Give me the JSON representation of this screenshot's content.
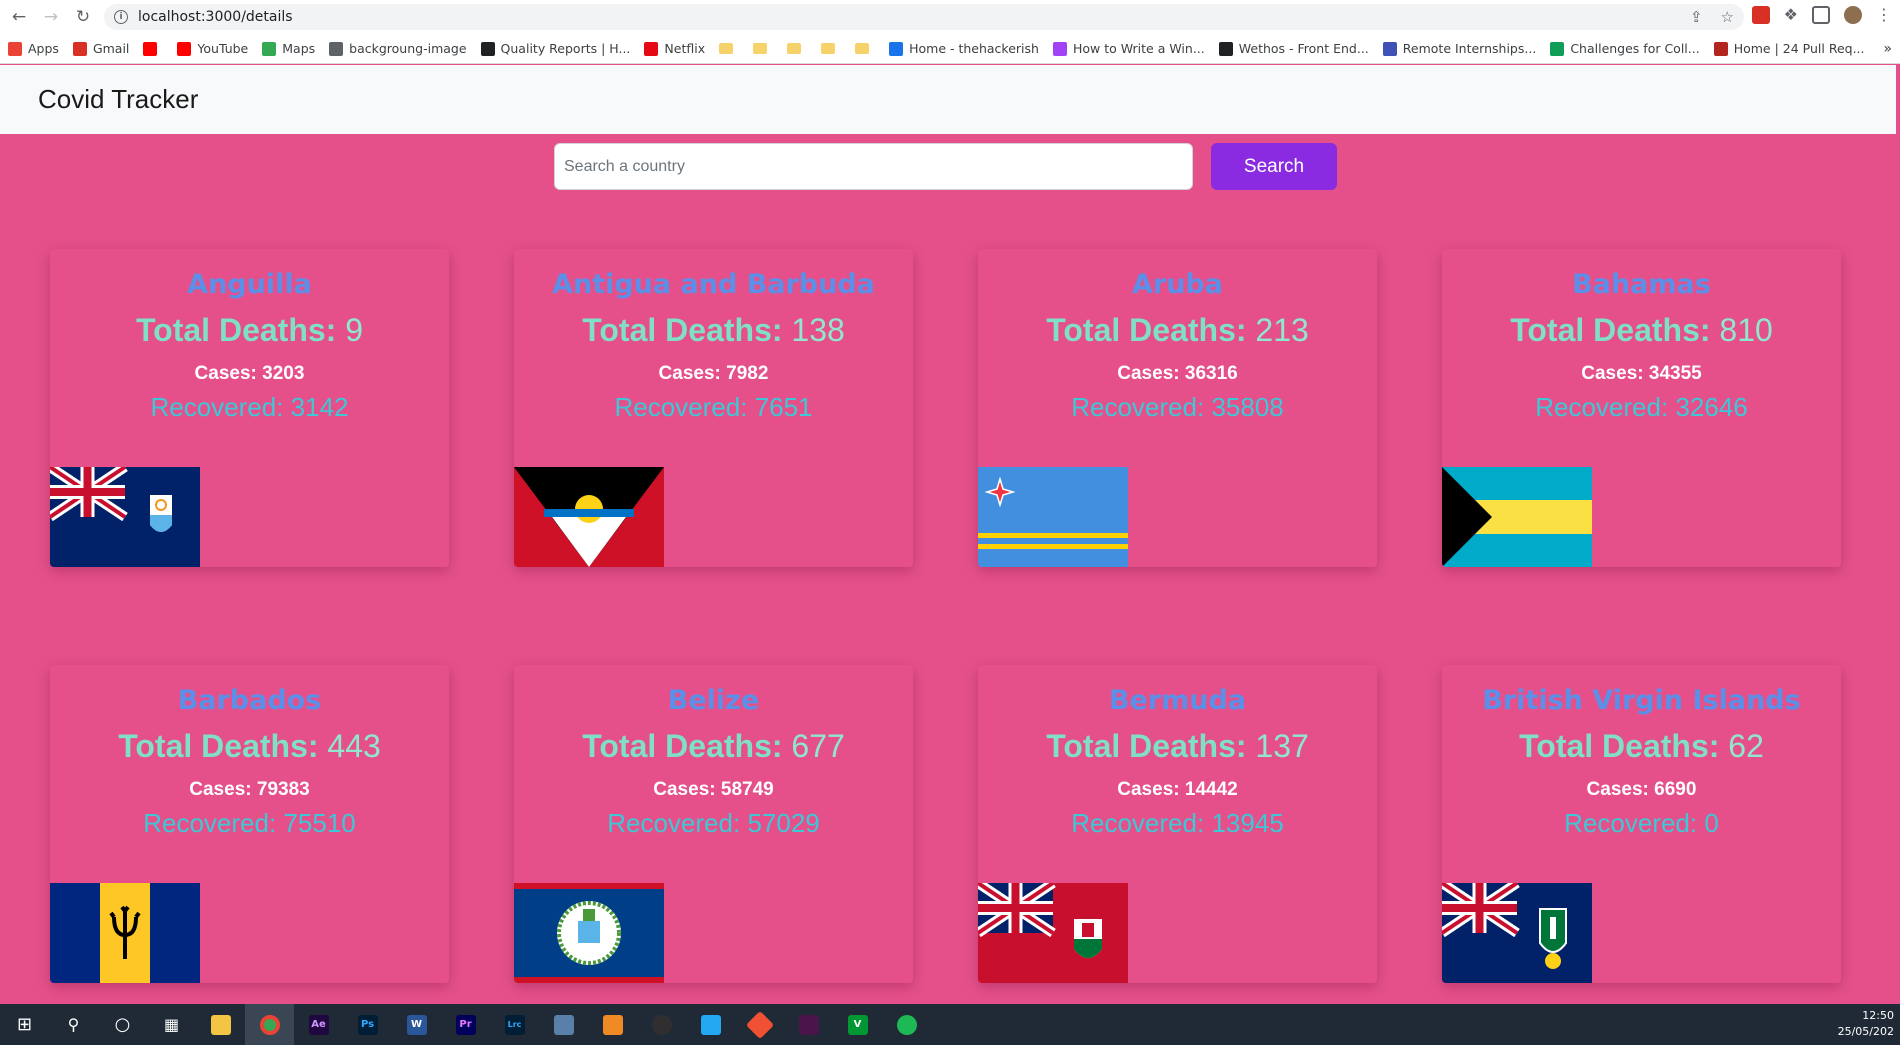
{
  "browser": {
    "url": "localhost:3000/details",
    "bookmarks": [
      {
        "label": "Apps",
        "color": "#ea4335"
      },
      {
        "label": "Gmail",
        "color": "#d93025"
      },
      {
        "label": "",
        "color": "#ff0000"
      },
      {
        "label": "YouTube",
        "color": "#ff0000"
      },
      {
        "label": "Maps",
        "color": "#34a853"
      },
      {
        "label": "backgroung-image",
        "color": "#5f6368"
      },
      {
        "label": "Quality Reports | H...",
        "color": "#202124"
      },
      {
        "label": "Netflix",
        "color": "#e50914"
      },
      {
        "label": "",
        "color": "#f6d26b",
        "folder": true
      },
      {
        "label": "",
        "color": "#f6d26b",
        "folder": true
      },
      {
        "label": "",
        "color": "#f6d26b",
        "folder": true
      },
      {
        "label": "",
        "color": "#f6d26b",
        "folder": true
      },
      {
        "label": "",
        "color": "#f6d26b",
        "folder": true
      },
      {
        "label": "Home - thehackerish",
        "color": "#1a73e8"
      },
      {
        "label": "How to Write a Win...",
        "color": "#a142f4"
      },
      {
        "label": "Wethos - Front End...",
        "color": "#202124"
      },
      {
        "label": "Remote Internships...",
        "color": "#3f51b5"
      },
      {
        "label": "Challenges for Coll...",
        "color": "#0f9d58"
      },
      {
        "label": "Home | 24 Pull Req...",
        "color": "#b3261e"
      }
    ],
    "more": "»"
  },
  "app": {
    "brand": "Covid Tracker",
    "search_placeholder": "Search a country",
    "search_label": "Search",
    "deaths_label": "Total Deaths:",
    "cases_label": "Cases:",
    "recovered_label": "Recovered:"
  },
  "countries": [
    {
      "name": "Anguilla",
      "deaths": "9",
      "cases": "3203",
      "recovered": "3142",
      "flag": "anguilla"
    },
    {
      "name": "Antigua and Barbuda",
      "deaths": "138",
      "cases": "7982",
      "recovered": "7651",
      "flag": "antigua"
    },
    {
      "name": "Aruba",
      "deaths": "213",
      "cases": "36316",
      "recovered": "35808",
      "flag": "aruba"
    },
    {
      "name": "Bahamas",
      "deaths": "810",
      "cases": "34355",
      "recovered": "32646",
      "flag": "bahamas"
    },
    {
      "name": "Barbados",
      "deaths": "443",
      "cases": "79383",
      "recovered": "75510",
      "flag": "barbados"
    },
    {
      "name": "Belize",
      "deaths": "677",
      "cases": "58749",
      "recovered": "57029",
      "flag": "belize"
    },
    {
      "name": "Bermuda",
      "deaths": "137",
      "cases": "14442",
      "recovered": "13945",
      "flag": "bermuda"
    },
    {
      "name": "British Virgin Islands",
      "deaths": "62",
      "cases": "6690",
      "recovered": "0",
      "flag": "bvi"
    }
  ],
  "taskbar": {
    "time": "12:50",
    "date": "25/05/202"
  },
  "colors": {
    "background": "#e5508a",
    "country_name": "#5b8fe8",
    "deaths": "#7fe0c4",
    "recovered": "#3ec7d6",
    "search_button": "#8a2be2"
  }
}
